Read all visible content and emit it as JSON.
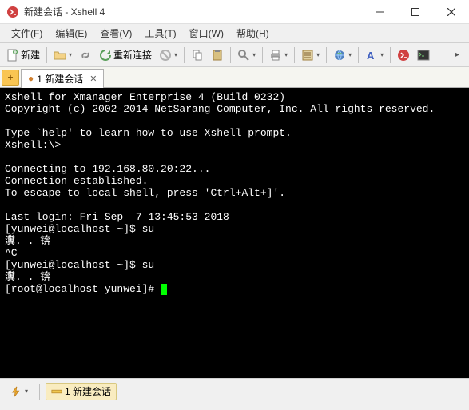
{
  "window": {
    "title": "新建会话 - Xshell 4",
    "app_name": "Xshell 4"
  },
  "menu": {
    "file": "文件(F)",
    "edit": "编辑(E)",
    "view": "查看(V)",
    "tools": "工具(T)",
    "window": "窗口(W)",
    "help": "帮助(H)"
  },
  "toolbar": {
    "new_label": "新建",
    "reconnect_label": "重新连接"
  },
  "tabs": {
    "active": "1 新建会话",
    "add_symbol": "+"
  },
  "terminal": {
    "lines": [
      "Xshell for Xmanager Enterprise 4 (Build 0232)",
      "Copyright (c) 2002-2014 NetSarang Computer, Inc. All rights reserved.",
      "",
      "Type `help' to learn how to use Xshell prompt.",
      "Xshell:\\>",
      "",
      "Connecting to 192.168.80.20:22...",
      "Connection established.",
      "To escape to local shell, press 'Ctrl+Alt+]'.",
      "",
      "Last login: Fri Sep  7 13:45:53 2018",
      "[yunwei@localhost ~]$ su",
      "瀵. . 锛",
      "^C",
      "[yunwei@localhost ~]$ su",
      "瀵. . 锛",
      "[root@localhost yunwei]# "
    ]
  },
  "statusbar": {
    "session_label": "1 新建会话"
  },
  "colors": {
    "terminal_bg": "#000000",
    "terminal_fg": "#ffffff",
    "cursor": "#00ff00",
    "accent_orange": "#f9c552"
  }
}
